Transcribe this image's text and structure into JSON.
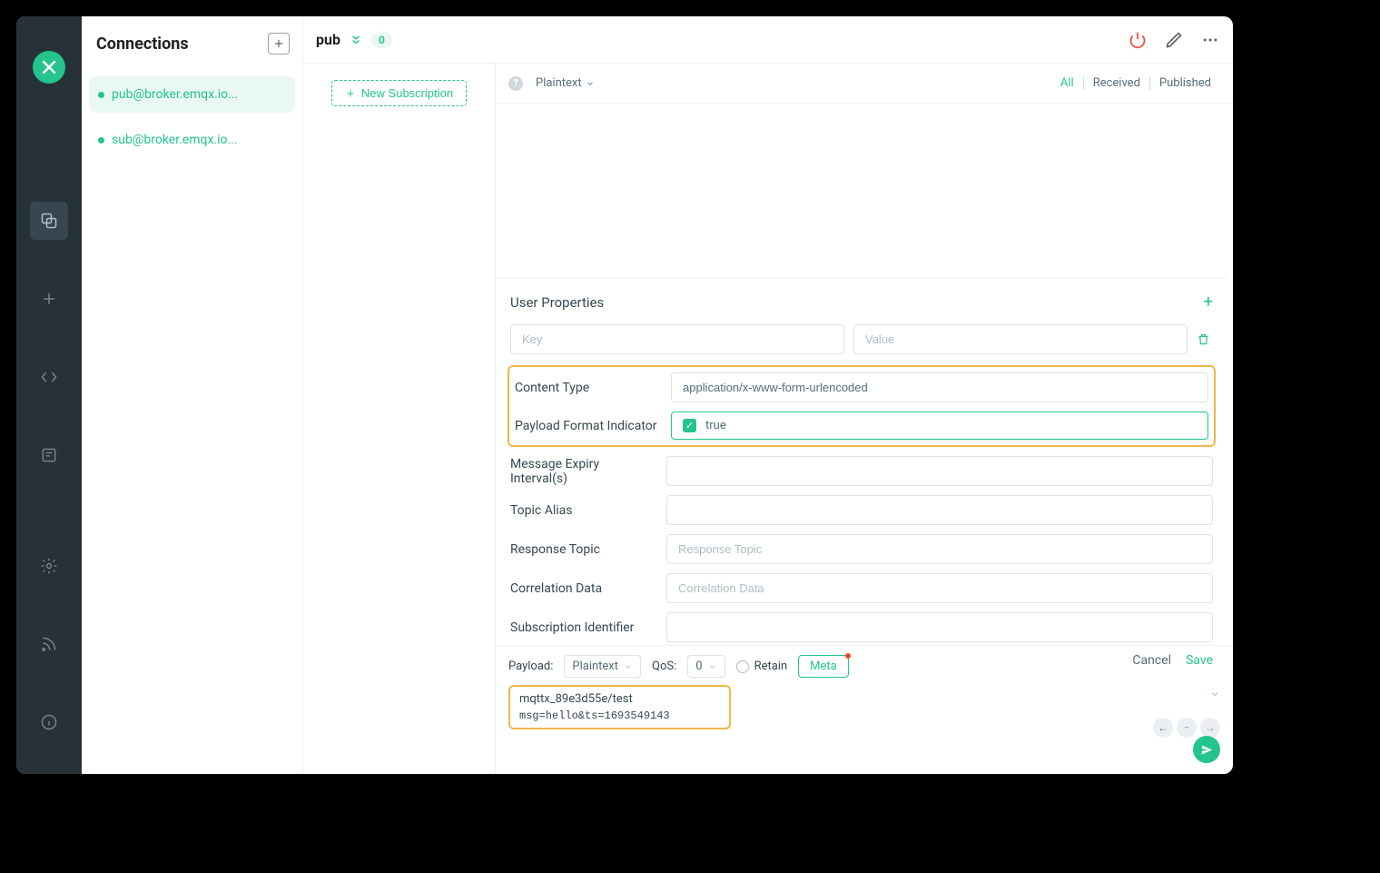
{
  "sidebar": {
    "title": "Connections",
    "connections": [
      {
        "name": "pub@broker.emqx.io..."
      },
      {
        "name": "sub@broker.emqx.io..."
      }
    ]
  },
  "topbar": {
    "name": "pub",
    "badge": "0"
  },
  "subscription": {
    "button": "New Subscription"
  },
  "filter": {
    "codec": "Plaintext",
    "tabs": {
      "all": "All",
      "received": "Received",
      "published": "Published"
    }
  },
  "meta": {
    "user_properties": {
      "title": "User Properties",
      "key_placeholder": "Key",
      "value_placeholder": "Value"
    },
    "content_type": {
      "label": "Content Type",
      "value": "application/x-www-form-urlencoded"
    },
    "payload_format": {
      "label": "Payload Format Indicator",
      "value": "true"
    },
    "message_expiry": {
      "label": "Message Expiry Interval(s)",
      "value": ""
    },
    "topic_alias": {
      "label": "Topic Alias",
      "value": ""
    },
    "response_topic": {
      "label": "Response Topic",
      "placeholder": "Response Topic",
      "value": ""
    },
    "correlation_data": {
      "label": "Correlation Data",
      "placeholder": "Correlation Data",
      "value": ""
    },
    "subscription_id": {
      "label": "Subscription Identifier",
      "value": ""
    },
    "cancel": "Cancel",
    "save": "Save"
  },
  "publish": {
    "payload_label": "Payload:",
    "payload_codec": "Plaintext",
    "qos_label": "QoS:",
    "qos_value": "0",
    "retain_label": "Retain",
    "meta_label": "Meta",
    "topic": "mqttx_89e3d55e/test",
    "body": "msg=hello&ts=1693549143"
  }
}
